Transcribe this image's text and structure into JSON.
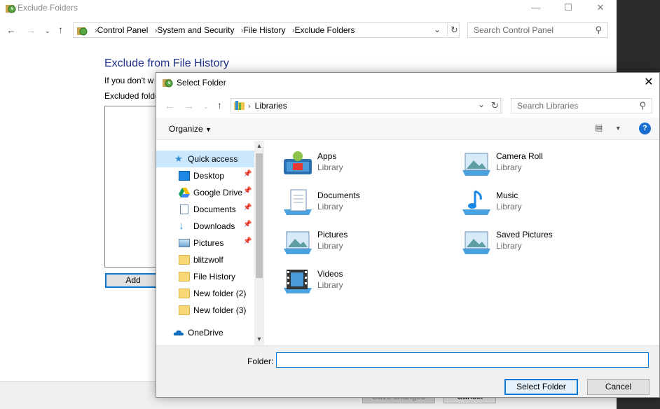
{
  "background_window": {
    "title": "Exclude Folders",
    "breadcrumbs": [
      "Control Panel",
      "System and Security",
      "File History",
      "Exclude Folders"
    ],
    "search_placeholder": "Search Control Panel",
    "heading": "Exclude from File History",
    "info_text": "If you don't w",
    "excluded_label": "Excluded folde",
    "add_label": "Add",
    "save_label": "Save changes",
    "cancel_label": "Cancel"
  },
  "dialog": {
    "title": "Select Folder",
    "address": "Libraries",
    "search_placeholder": "Search Libraries",
    "organize_label": "Organize",
    "nav_items": [
      {
        "label": "Quick access",
        "icon": "star-icon"
      },
      {
        "label": "Desktop",
        "icon": "desktop-icon",
        "pinned": true
      },
      {
        "label": "Google Drive",
        "icon": "google-drive-icon",
        "pinned": true
      },
      {
        "label": "Documents",
        "icon": "documents-icon",
        "pinned": true
      },
      {
        "label": "Downloads",
        "icon": "download-arrow-icon",
        "pinned": true
      },
      {
        "label": "Pictures",
        "icon": "pictures-icon",
        "pinned": true
      },
      {
        "label": "blitzwolf",
        "icon": "folder-icon"
      },
      {
        "label": "File History",
        "icon": "folder-icon"
      },
      {
        "label": "New folder (2)",
        "icon": "folder-icon"
      },
      {
        "label": "New folder (3)",
        "icon": "folder-icon"
      },
      {
        "label": "OneDrive",
        "icon": "cloud-icon"
      }
    ],
    "libraries": [
      {
        "name": "Apps",
        "type": "Library",
        "icon": "apps-library-icon"
      },
      {
        "name": "Camera Roll",
        "type": "Library",
        "icon": "camera-roll-library-icon"
      },
      {
        "name": "Documents",
        "type": "Library",
        "icon": "documents-library-icon"
      },
      {
        "name": "Music",
        "type": "Library",
        "icon": "music-library-icon"
      },
      {
        "name": "Pictures",
        "type": "Library",
        "icon": "pictures-library-icon"
      },
      {
        "name": "Saved Pictures",
        "type": "Library",
        "icon": "saved-pictures-library-icon"
      },
      {
        "name": "Videos",
        "type": "Library",
        "icon": "videos-library-icon"
      }
    ],
    "folder_label": "Folder:",
    "folder_value": "",
    "select_label": "Select Folder",
    "cancel_label": "Cancel"
  },
  "colors": {
    "heading_blue": "#1e3287",
    "selection": "#cce8ff",
    "accent": "#0078d7"
  }
}
